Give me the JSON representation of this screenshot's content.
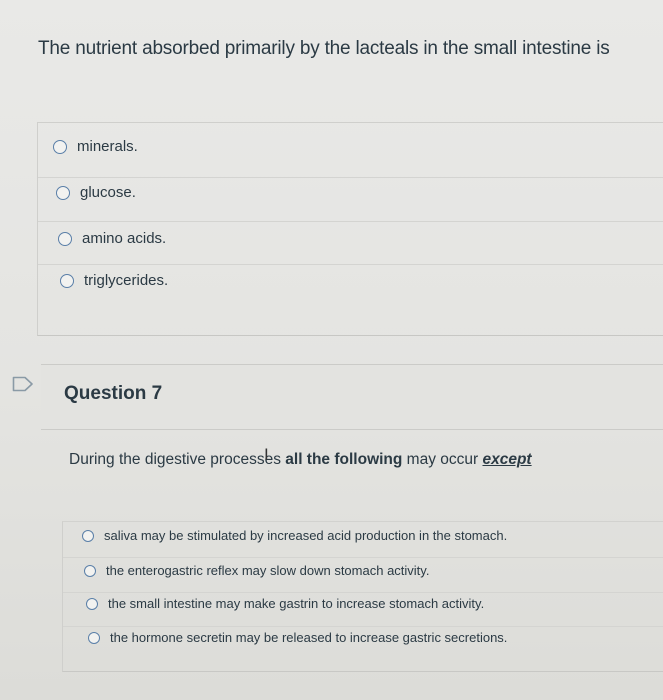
{
  "question6": {
    "prompt": "The nutrient absorbed primarily by the lacteals in the small intestine is",
    "options": [
      "minerals.",
      "glucose.",
      "amino acids.",
      "triglycerides."
    ]
  },
  "question7": {
    "title": "Question 7",
    "prompt_start": "During the digestive processes ",
    "prompt_bold": "all the following",
    "prompt_mid": " may occur ",
    "prompt_except": "except",
    "options": [
      "saliva may be stimulated by increased acid production in the stomach.",
      "the enterogastric reflex may slow down stomach activity.",
      "the small intestine may make gastrin to increase stomach activity.",
      "the hormone secretin may be released to increase gastric secretions."
    ]
  },
  "icons": {
    "flag": "flag-icon",
    "radio": "radio-circle",
    "cursor": "text-cursor-icon"
  },
  "colors": {
    "text": "#2b3a44",
    "radio_border": "#5a7fa8",
    "background": "#e6e6e3"
  }
}
